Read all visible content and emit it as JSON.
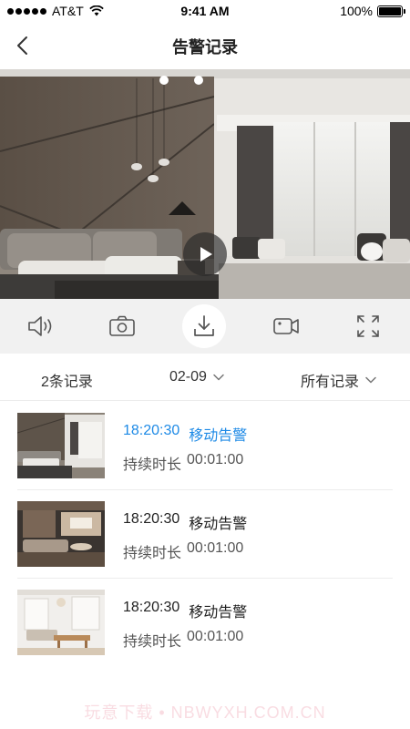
{
  "status_bar": {
    "carrier": "AT&T",
    "time": "9:41 AM",
    "battery": "100%",
    "signal_icon": "signal-dots-icon",
    "wifi_icon": "wifi-icon",
    "battery_icon": "battery-icon"
  },
  "header": {
    "title": "告警记录",
    "back_icon": "chevron-left-icon"
  },
  "video": {
    "play_icon": "play-icon"
  },
  "toolbar": {
    "items": [
      {
        "icon": "speaker-icon"
      },
      {
        "icon": "camera-icon"
      },
      {
        "icon": "download-icon"
      },
      {
        "icon": "video-camera-icon"
      },
      {
        "icon": "fullscreen-icon"
      }
    ]
  },
  "filters": {
    "count": "2条记录",
    "date": "02-09",
    "type": "所有记录"
  },
  "records": [
    {
      "time": "18:20:30",
      "event": "移动告警",
      "duration_label": "持续时长",
      "duration": "00:01:00",
      "selected": true
    },
    {
      "time": "18:20:30",
      "event": "移动告警",
      "duration_label": "持续时长",
      "duration": "00:01:00",
      "selected": false
    },
    {
      "time": "18:20:30",
      "event": "移动告警",
      "duration_label": "持续时长",
      "duration": "00:01:00",
      "selected": false
    }
  ],
  "watermark": "玩意下载 • NBWYXH.COM.CN",
  "colors": {
    "accent": "#1e8ae6",
    "toolbar_bg": "#f1f1f1"
  }
}
